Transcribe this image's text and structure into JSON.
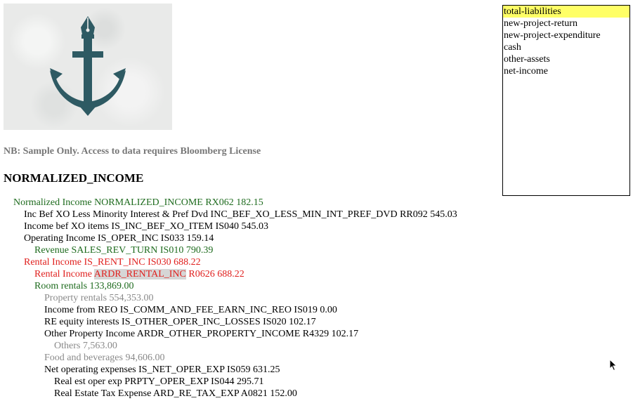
{
  "logo": {
    "icon": "anchor-pen-icon",
    "color": "#2e5a63"
  },
  "note": "NB: Sample Only. Access to data requires Bloomberg License",
  "heading": "NORMALIZED_INCOME",
  "tree": [
    {
      "text": "Normalized Income NORMALIZED_INCOME RX062 182.15",
      "color": "green"
    },
    {
      "text": "Inc Bef XO Less Minority Interest & Pref Dvd INC_BEF_XO_LESS_MIN_INT_PREF_DVD RR092 545.03",
      "color": "black"
    },
    {
      "text": "Income bef XO items IS_INC_BEF_XO_ITEM IS040 545.03",
      "color": "black"
    },
    {
      "text": "Operating Income IS_OPER_INC IS033 159.14",
      "color": "black"
    },
    {
      "text": "Revenue SALES_REV_TURN IS010 790.39",
      "color": "green"
    },
    {
      "text": "Rental Income IS_RENT_INC IS030 688.22",
      "color": "red"
    },
    {
      "pre": "Rental Income ",
      "hl": "ARDR_RENTAL_INC",
      "post": " R0626 688.22",
      "color": "red"
    },
    {
      "text": "Room rentals 133,869.00",
      "color": "green"
    },
    {
      "text": "Property rentals 554,353.00",
      "color": "gray"
    },
    {
      "text": "Income from REO IS_COMM_AND_FEE_EARN_INC_REO IS019 0.00",
      "color": "black"
    },
    {
      "text": "RE equity interests IS_OTHER_OPER_INC_LOSSES IS020 102.17",
      "color": "black"
    },
    {
      "text": "Other Property Income ARDR_OTHER_PROPERTY_INCOME R4329 102.17",
      "color": "black"
    },
    {
      "text": "Others 7,563.00",
      "color": "gray"
    },
    {
      "text": "Food and beverages 94,606.00",
      "color": "gray"
    },
    {
      "text": "Net operating expenses IS_NET_OPER_EXP IS059 631.25",
      "color": "black"
    },
    {
      "text": "Real est oper exp PRPTY_OPER_EXP IS044 295.71",
      "color": "black"
    },
    {
      "text": "Real Estate Tax Expense ARD_RE_TAX_EXP A0821 152.00",
      "color": "black"
    }
  ],
  "list": {
    "items": [
      "total-liabilities",
      "new-project-return",
      "new-project-expenditure",
      "cash",
      "other-assets",
      "net-income"
    ],
    "selected": "total-liabilities"
  },
  "cursor": {
    "icon": "mouse-pointer-icon"
  }
}
